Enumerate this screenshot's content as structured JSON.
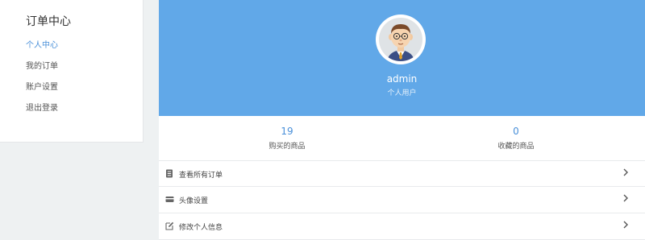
{
  "sidebar": {
    "title": "订单中心",
    "items": [
      {
        "label": "个人中心",
        "active": true
      },
      {
        "label": "我的订单"
      },
      {
        "label": "账户设置"
      },
      {
        "label": "退出登录"
      }
    ]
  },
  "profile": {
    "avatar_icon": "avatar-cartoon-man",
    "username": "admin",
    "role": "个人用户"
  },
  "stats": [
    {
      "value": "19",
      "label": "购买的商品"
    },
    {
      "value": "0",
      "label": "收藏的商品"
    }
  ],
  "menu": [
    {
      "icon": "order-list-icon",
      "label": "查看所有订单"
    },
    {
      "icon": "card-icon",
      "label": "头像设置"
    },
    {
      "icon": "edit-icon",
      "label": "修改个人信息"
    }
  ],
  "colors": {
    "accent": "#4a90d9",
    "banner": "#61a8e8",
    "page_background": "#eef1f2"
  }
}
